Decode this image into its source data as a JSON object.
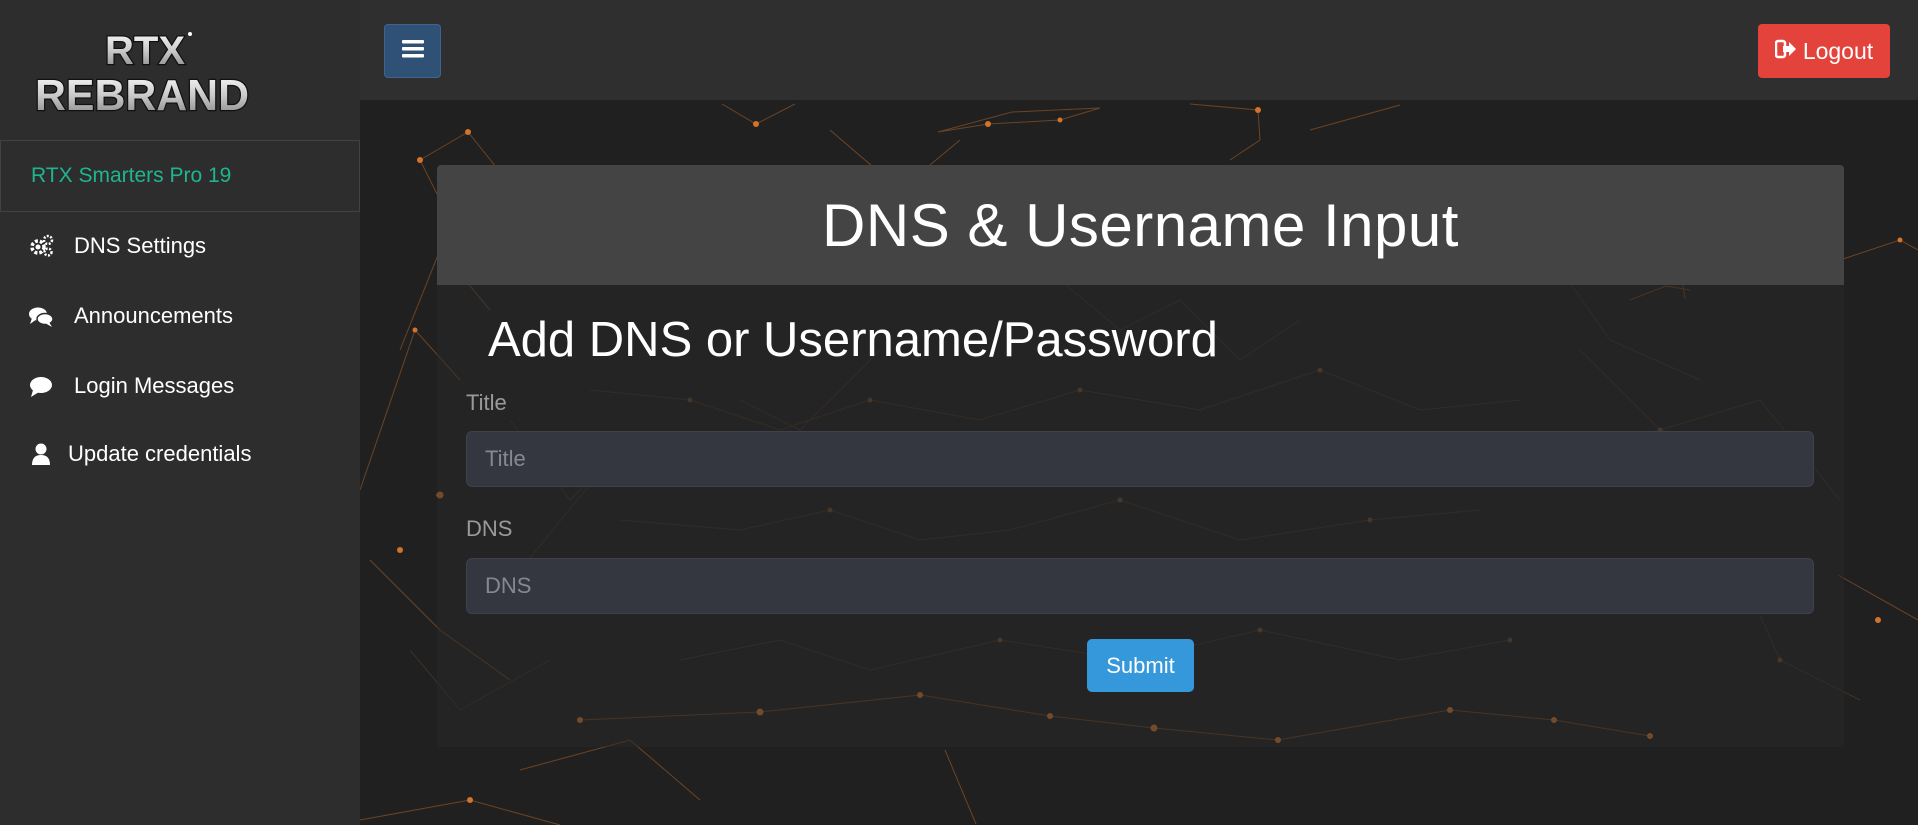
{
  "app": {
    "logo_line1": "RTX",
    "logo_line2": "REBRAND",
    "brand_name": "RTX Smarters Pro 19"
  },
  "sidebar": {
    "items": [
      {
        "label": "DNS Settings",
        "icon": "gears-icon"
      },
      {
        "label": "Announcements",
        "icon": "comments-icon"
      },
      {
        "label": "Login Messages",
        "icon": "comment-icon"
      },
      {
        "label": "Update credentials",
        "icon": "user-icon"
      }
    ]
  },
  "topbar": {
    "menu_icon": "hamburger-icon",
    "logout_label": "Logout",
    "logout_icon": "sign-out-icon"
  },
  "main": {
    "header_title": "DNS & Username Input",
    "form_title": "Add DNS or Username/Password",
    "fields": [
      {
        "label": "Title",
        "placeholder": "Title"
      },
      {
        "label": "DNS",
        "placeholder": "DNS"
      }
    ],
    "submit_label": "Submit"
  },
  "colors": {
    "brand_green": "#1fb58f",
    "logout_red": "#e3433a",
    "submit_blue": "#3498db",
    "menu_blue": "#2f5176",
    "network_orange": "#e07a2e"
  }
}
